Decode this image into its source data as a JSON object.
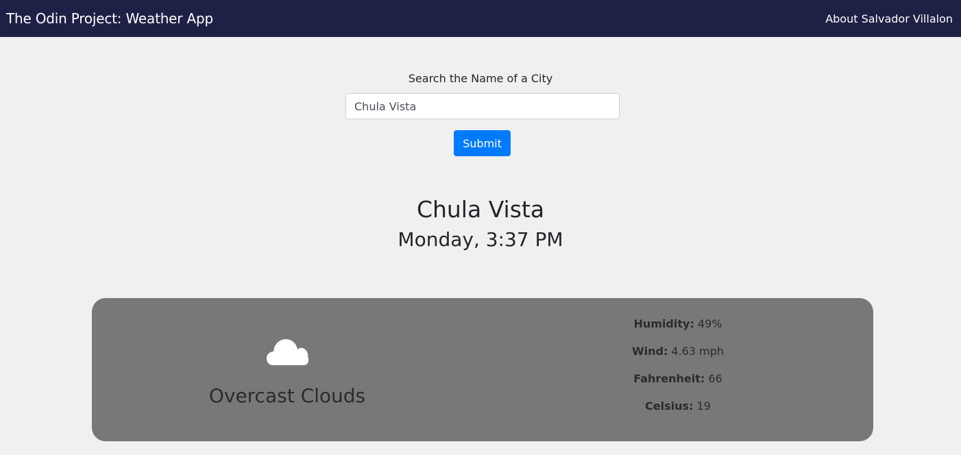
{
  "navbar": {
    "brand": "The Odin Project: Weather App",
    "about_link": "About Salvador Villalon"
  },
  "search": {
    "label": "Search the Name of a City",
    "value": "Chula Vista",
    "submit_label": "Submit"
  },
  "location": {
    "city": "Chula Vista",
    "datetime": "Monday, 3:37 PM"
  },
  "weather": {
    "icon": "cloud-icon",
    "description": "Overcast Clouds",
    "stats": [
      {
        "label": "Humidity:",
        "value": " 49%"
      },
      {
        "label": "Wind:",
        "value": " 4.63 mph"
      },
      {
        "label": "Fahrenheit:",
        "value": " 66"
      },
      {
        "label": "Celsius:",
        "value": " 19"
      }
    ]
  },
  "colors": {
    "navbar_bg": "#1e2046",
    "page_bg": "#f0f0f0",
    "submit_bg": "#007bff",
    "card_bg": "#787878"
  }
}
